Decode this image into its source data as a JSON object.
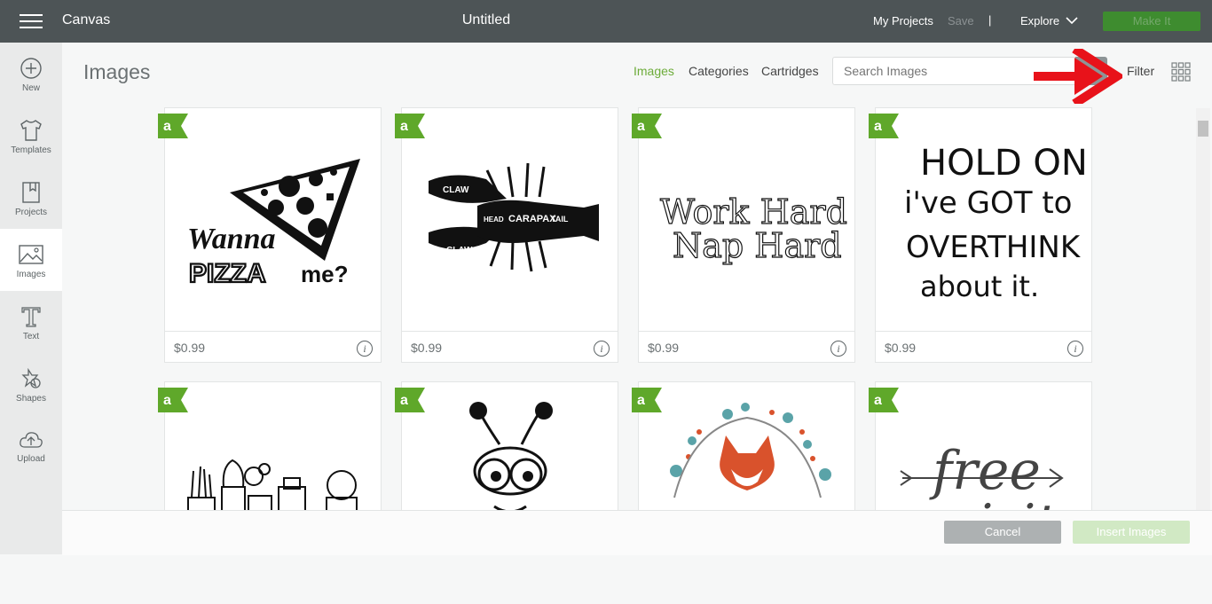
{
  "topbar": {
    "app_title": "Canvas",
    "doc_title": "Untitled",
    "my_projects": "My Projects",
    "save": "Save",
    "separator": "|",
    "explore": "Explore",
    "make_it": "Make It"
  },
  "sidebar": {
    "items": [
      {
        "label": "New",
        "icon": "plus-circle-icon"
      },
      {
        "label": "Templates",
        "icon": "tshirt-icon"
      },
      {
        "label": "Projects",
        "icon": "bookmark-book-icon"
      },
      {
        "label": "Images",
        "icon": "image-icon"
      },
      {
        "label": "Text",
        "icon": "text-t-icon"
      },
      {
        "label": "Shapes",
        "icon": "shapes-icon"
      },
      {
        "label": "Upload",
        "icon": "cloud-upload-icon"
      }
    ]
  },
  "main": {
    "title": "Images",
    "tabs": [
      "Images",
      "Categories",
      "Cartridges"
    ],
    "search_placeholder": "Search Images",
    "filter": "Filter"
  },
  "cards": [
    {
      "price": "$0.99",
      "art_text": [
        "Wanna",
        "PIZZA",
        "me?"
      ]
    },
    {
      "price": "$0.99",
      "art_text": [
        "CLAW",
        "CLAW",
        "HEAD",
        "CARAPAX",
        "TAIL"
      ]
    },
    {
      "price": "$0.99",
      "art_text": [
        "Work Hard",
        "Nap Hard"
      ]
    },
    {
      "price": "$0.99",
      "art_text": [
        "HOLD ON",
        "i've GOT to",
        "OVERTHINK",
        "about it."
      ]
    },
    {
      "price": "",
      "art_text": []
    },
    {
      "price": "",
      "art_text": []
    },
    {
      "price": "",
      "art_text": []
    },
    {
      "price": "",
      "art_text": [
        "free",
        "spirit"
      ]
    }
  ],
  "footer": {
    "cancel": "Cancel",
    "insert": "Insert Images"
  },
  "colors": {
    "topbar": "#4d5456",
    "accent_green": "#6dac3a",
    "make_it": "#3e8c2f",
    "arrow_red": "#e8121a"
  }
}
